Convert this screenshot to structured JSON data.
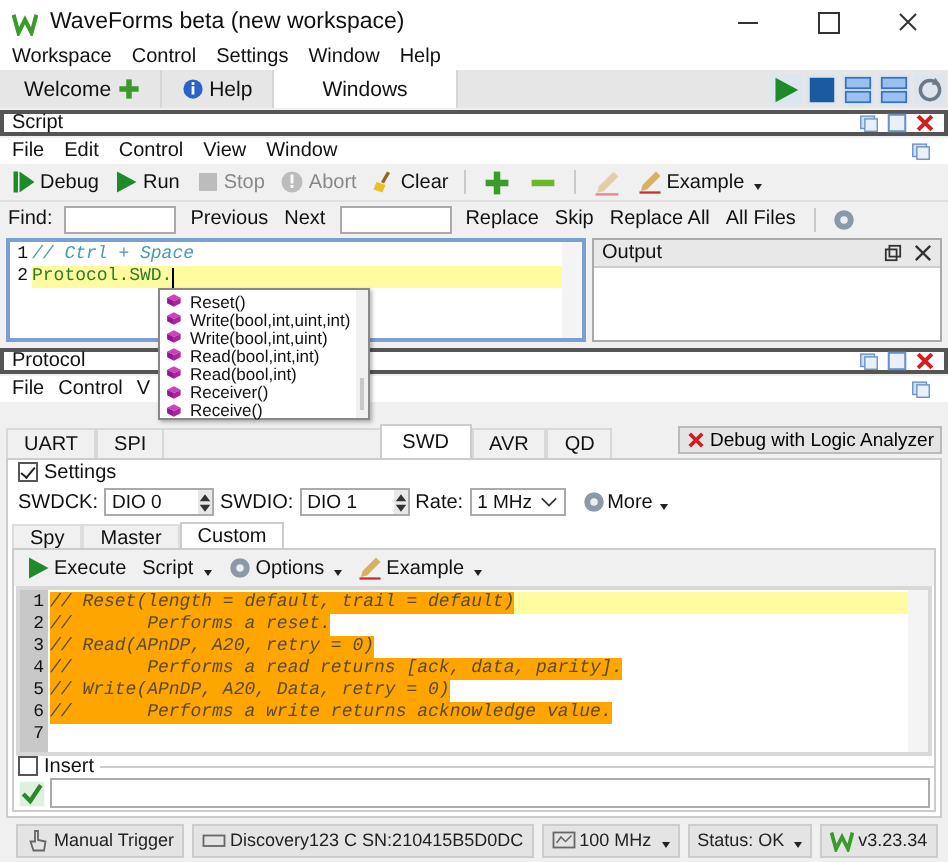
{
  "window": {
    "title": "WaveForms beta (new workspace)"
  },
  "menu": [
    "Workspace",
    "Control",
    "Settings",
    "Window",
    "Help"
  ],
  "workspace_tabs": [
    {
      "label": "Welcome",
      "selected": false
    },
    {
      "label": "Help",
      "selected": false
    },
    {
      "label": "Windows",
      "selected": true
    }
  ],
  "script": {
    "title": "Script",
    "menu": [
      "File",
      "Edit",
      "Control",
      "View",
      "Window"
    ],
    "toolbar": [
      {
        "kind": "button",
        "label": "Debug",
        "disabled": false
      },
      {
        "kind": "button",
        "label": "Run",
        "disabled": false
      },
      {
        "kind": "button",
        "label": "Stop",
        "disabled": true
      },
      {
        "kind": "button",
        "label": "Abort",
        "disabled": true
      },
      {
        "kind": "button",
        "label": "Clear",
        "disabled": false
      },
      {
        "kind": "separator"
      },
      {
        "kind": "icon",
        "disabled": false
      },
      {
        "kind": "icon",
        "disabled": false
      },
      {
        "kind": "separator"
      },
      {
        "kind": "icon",
        "disabled": true
      },
      {
        "kind": "menu",
        "label": "Example",
        "disabled": false
      }
    ],
    "find": {
      "label": "Find:",
      "buttons_a": [
        "Previous",
        "Next"
      ],
      "buttons_b": [
        "Replace",
        "Skip",
        "Replace All",
        "All Files"
      ]
    },
    "lines": [
      {
        "number": "1",
        "text": "// Ctrl + Space",
        "kind": "comment",
        "current": false
      },
      {
        "number": "2",
        "text": "Protocol.SWD.",
        "kind": "code",
        "current": true
      }
    ],
    "completions": [
      {
        "label": "Reset()",
        "selected": false
      },
      {
        "label": "Write(bool,int,uint,int)",
        "selected": false
      },
      {
        "label": "Write(bool,int,uint)",
        "selected": false
      },
      {
        "label": "Read(bool,int,int)",
        "selected": false
      },
      {
        "label": "Read(bool,int)",
        "selected": false
      },
      {
        "label": "Receiver()",
        "selected": false
      },
      {
        "label": "Receive()",
        "selected": false
      }
    ],
    "output": {
      "title": "Output"
    }
  },
  "protocol": {
    "title": "Protocol",
    "menu": [
      "File",
      "Control",
      "V"
    ],
    "tabs": [
      {
        "label": "UART",
        "selected": false
      },
      {
        "label": "SPI",
        "selected": false
      },
      {
        "label": "SWD",
        "selected": true
      },
      {
        "label": "AVR",
        "selected": false
      },
      {
        "label": "QD",
        "selected": false
      }
    ],
    "debug_button": "Debug with Logic Analyzer",
    "settings": {
      "label": "Settings",
      "checked": true
    },
    "fields": [
      {
        "label": "SWDCK:",
        "value": "DIO 0",
        "kind": "spin"
      },
      {
        "label": "SWDIO:",
        "value": "DIO 1",
        "kind": "spin"
      },
      {
        "label": "Rate:",
        "value": "1 MHz",
        "kind": "combo"
      }
    ],
    "more": "More",
    "subtabs": [
      {
        "label": "Spy",
        "selected": false
      },
      {
        "label": "Master",
        "selected": false
      },
      {
        "label": "Custom",
        "selected": true
      }
    ],
    "toolbar": [
      {
        "label": "Execute",
        "dropdown": false
      },
      {
        "label": "Script",
        "dropdown": true
      },
      {
        "label": "Options",
        "dropdown": true
      },
      {
        "label": "Example",
        "dropdown": true
      }
    ],
    "code": [
      {
        "number": "1",
        "text": "// Reset(length = default, trail = default)",
        "selected": true,
        "current": true
      },
      {
        "number": "2",
        "text": "//       Performs a reset.",
        "selected": true,
        "current": false
      },
      {
        "number": "3",
        "text": "// Read(APnDP, A20, retry = 0)",
        "selected": true,
        "current": false
      },
      {
        "number": "4",
        "text": "//       Performs a read returns [ack, data, parity].",
        "selected": true,
        "current": false
      },
      {
        "number": "5",
        "text": "// Write(APnDP, A20, Data, retry = 0)",
        "selected": true,
        "current": false
      },
      {
        "number": "6",
        "text": "//       Performs a write returns acknowledge value.",
        "selected": true,
        "current": false
      },
      {
        "number": "7",
        "selected": false,
        "current": false
      }
    ],
    "insert": {
      "label": "Insert",
      "checked": false
    }
  },
  "status_bar": [
    {
      "label": "Manual Trigger",
      "dropdown": false
    },
    {
      "label": "Discovery123 C SN:210415B5D0DC",
      "dropdown": false
    },
    {
      "label": "100 MHz",
      "dropdown": true
    },
    {
      "label": "Status: OK",
      "dropdown": true
    },
    {
      "label": "v3.23.34",
      "dropdown": false
    }
  ]
}
